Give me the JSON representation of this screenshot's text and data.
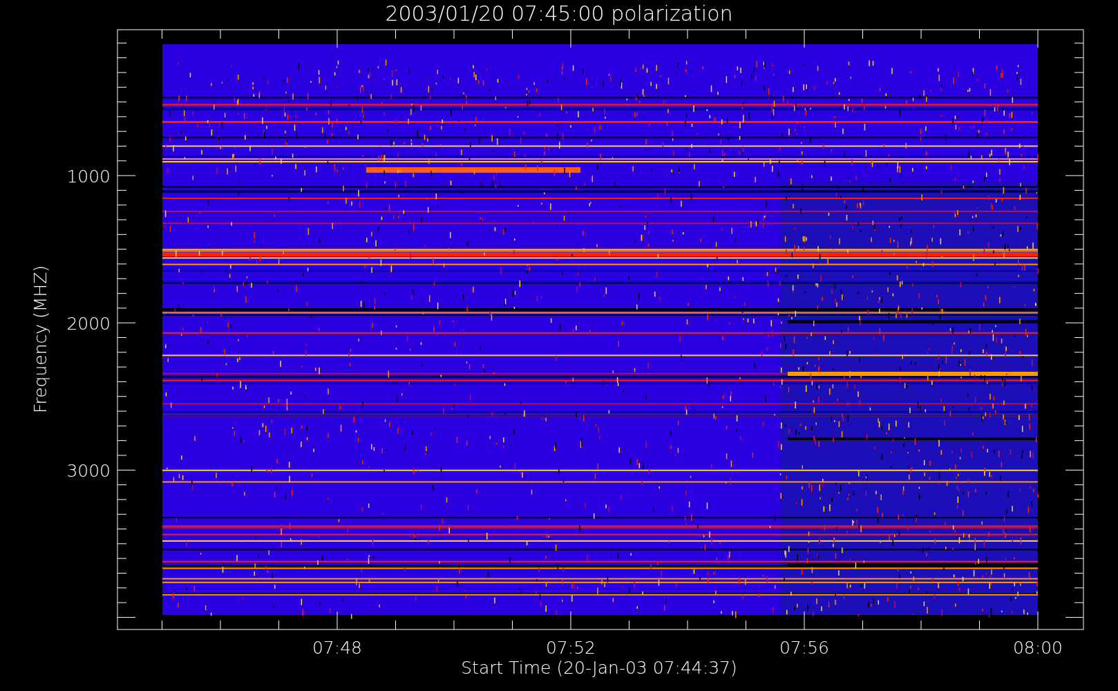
{
  "title": "2003/01/20 07:45:00 polarization",
  "y_axis": {
    "label": "Frequency (MHZ)",
    "ticks": [
      "1000",
      "2000",
      "3000"
    ]
  },
  "x_axis": {
    "label": "Start Time (20-Jan-03 07:44:37)",
    "ticks": [
      "07:48",
      "07:52",
      "07:56",
      "08:00"
    ]
  }
}
